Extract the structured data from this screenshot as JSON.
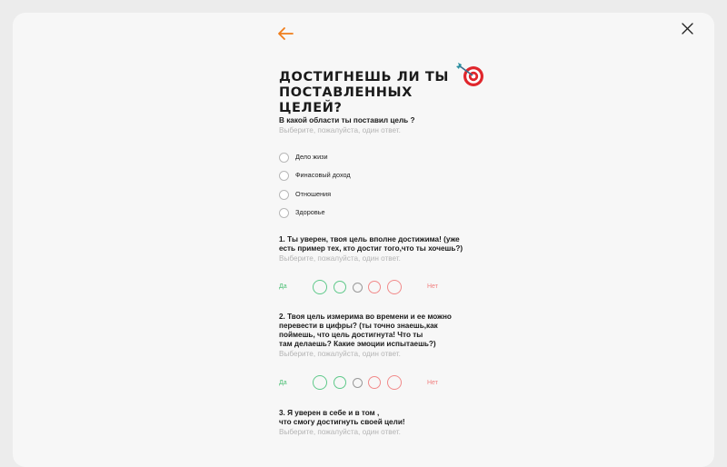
{
  "header": {
    "back_icon": "arrow-left-icon",
    "close_icon": "close-icon"
  },
  "title": {
    "text": "Достигнешь ли ты поставленных целей?",
    "emoji_icon": "target-icon"
  },
  "q0": {
    "text": "В какой области ты поставил цель ?",
    "hint": "Выберите, пожалуйста, один ответ.",
    "options": [
      "Дело жизи",
      "Финасовый доход",
      "Отношения",
      "Здоровье"
    ]
  },
  "q1": {
    "text": "1. Ты уверен, твоя цель вполне достижима! (уже\nесть пример тех, кто достиг того,что ты хочешь?)",
    "hint": "Выберите, пожалуйста, один ответ.",
    "yes": "Да",
    "no": "Нет"
  },
  "q2": {
    "text": "2. Твоя цель измерима во времени и ее можно\nперевести в цифры? (ты точно знаешь,как\nпоймешь, что цель достигнута! Что ты\nтам делаешь? Какие эмоции испытаешь?)",
    "hint": "Выберите, пожалуйста, один ответ.",
    "yes": "Да",
    "no": "Нет"
  },
  "q3": {
    "text": "3. Я уверен в себе и в том ,\nчто смогу достигнуть своей цели!",
    "hint": "Выберите, пожалуйста, один ответ."
  },
  "colors": {
    "accent": "#f07d1a",
    "agree": "#5fc98a",
    "disagree": "#f18a8a",
    "neutral": "#999999"
  }
}
